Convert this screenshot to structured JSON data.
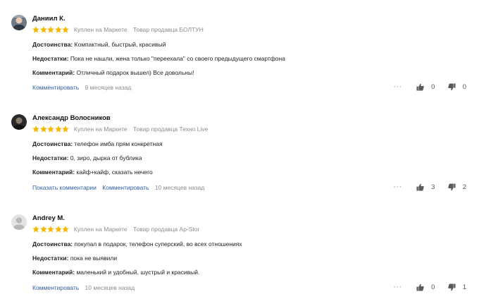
{
  "colors": {
    "star": "#f5b700",
    "link": "#2f5ea8",
    "muted": "#8c8c8c"
  },
  "icons": {
    "rating": "star-icon",
    "like": "thumbs-up-icon",
    "dislike": "thumbs-down-icon",
    "more": "more-dots-icon"
  },
  "reviews": [
    {
      "author": "Даниил К.",
      "rating": 5,
      "badge": "Куплен на Маркете",
      "seller": "Товар продавца БОЛТУН",
      "pros_label": "Достоинства:",
      "pros": "Компактный, быстрый, красивый",
      "cons_label": "Недостатки:",
      "cons": "Пока не нашли, жена только \"переехала\" со своего предыдущего смартфона",
      "comment_label": "Комментарий:",
      "comment": "Отличный подарок вышел) Все довольны!",
      "comment_link": "Комментировать",
      "date": "9 месяцев назад",
      "more": "···",
      "likes": "0",
      "dislikes": "0"
    },
    {
      "author": "Александр Волосников",
      "rating": 5,
      "badge": "Куплен на Маркете",
      "seller": "Товар продавца Техно Live",
      "pros_label": "Достоинства:",
      "pros": "телефон имба прям конкретная",
      "cons_label": "Недостатки:",
      "cons": "0, зиро, дырка от бублика",
      "comment_label": "Комментарий:",
      "comment": "кайф+кайф, сказать нечего",
      "show_comments_link": "Показать комментарии",
      "comment_link": "Комментировать",
      "date": "10 месяцев назад",
      "more": "···",
      "likes": "3",
      "dislikes": "2"
    },
    {
      "author": "Andrey M.",
      "rating": 5,
      "badge": "Куплен на Маркете",
      "seller": "Товар продавца Ap-Stor",
      "pros_label": "Достоинства:",
      "pros": "покупал в подарок, телефон суперский, во всех отношениях",
      "cons_label": "Недостатки:",
      "cons": "пока не выявили",
      "comment_label": "Комментарий:",
      "comment": "маленький и удобный, шустрый и красивый.",
      "comment_link": "Комментировать",
      "date": "10 месяцев назад",
      "more": "···",
      "likes": "0",
      "dislikes": "1"
    }
  ]
}
